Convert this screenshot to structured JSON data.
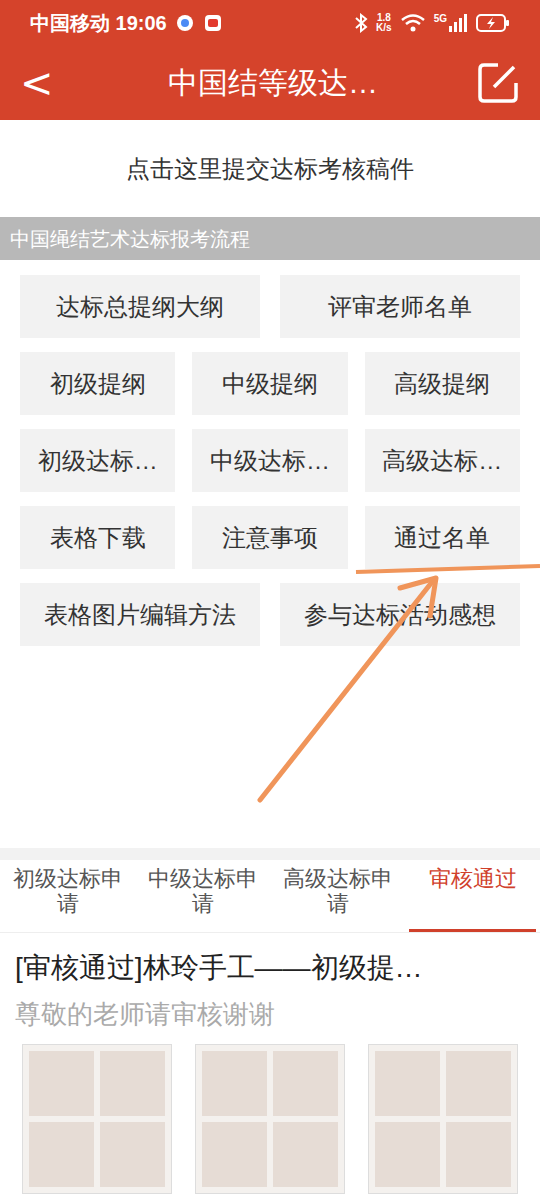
{
  "status_bar": {
    "carrier_time": "中国移动 19:06",
    "speed": "1.8",
    "speed_unit": "K/s",
    "network": "5G"
  },
  "title_bar": {
    "back": "<",
    "title": "中国结等级达…"
  },
  "submit_link": "点击这里提交达标考核稿件",
  "section": {
    "title": "中国绳结艺术达标报考流程"
  },
  "button_rows": [
    [
      "达标总提纲大纲",
      "评审老师名单"
    ],
    [
      "初级提纲",
      "中级提纲",
      "高级提纲"
    ],
    [
      "初级达标…",
      "中级达标…",
      "高级达标…"
    ],
    [
      "表格下载",
      "注意事项",
      "通过名单"
    ],
    [
      "表格图片编辑方法",
      "参与达标活动感想"
    ]
  ],
  "tabs": [
    {
      "label": "初级达标申请",
      "selected": false
    },
    {
      "label": "中级达标申请",
      "selected": false
    },
    {
      "label": "高级达标申请",
      "selected": false
    },
    {
      "label": "审核通过",
      "selected": true
    }
  ],
  "article": {
    "title": "[审核通过]林玲手工——初级提…",
    "subtitle": "尊敬的老师请审核谢谢",
    "thumbnails": [
      {
        "kind": "photo"
      },
      {
        "kind": "photo"
      },
      {
        "kind": "photo"
      }
    ]
  }
}
